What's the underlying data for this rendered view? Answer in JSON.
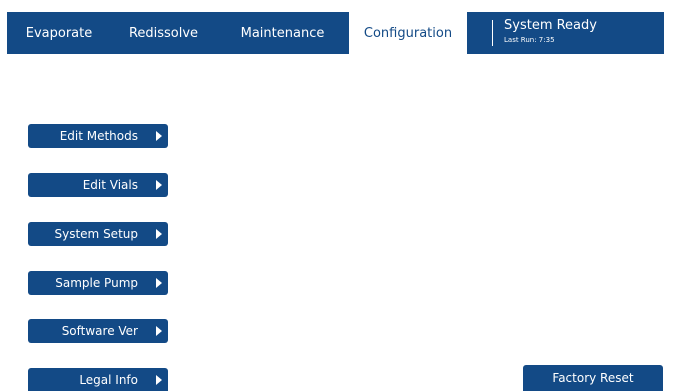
{
  "tabs": [
    {
      "label": "Evaporate"
    },
    {
      "label": "Redissolve"
    },
    {
      "label": "Maintenance"
    },
    {
      "label": "Configuration",
      "active": true
    }
  ],
  "status": {
    "title": "System Ready",
    "last_run": "Last Run: 7:35"
  },
  "menu": [
    {
      "label": "Edit Methods"
    },
    {
      "label": "Edit Vials"
    },
    {
      "label": "System Setup"
    },
    {
      "label": "Sample Pump"
    },
    {
      "label": "Software Ver"
    },
    {
      "label": "Legal Info"
    }
  ],
  "factory_reset_label": "Factory Reset",
  "colors": {
    "accent": "#134a86",
    "background": "#ffffff"
  }
}
